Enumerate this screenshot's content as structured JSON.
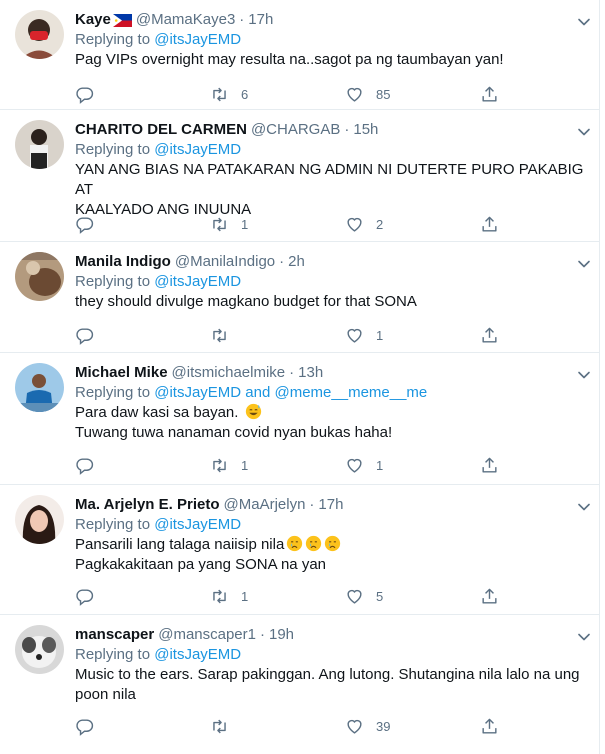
{
  "tweets": [
    {
      "name": "Kaye",
      "flag": "philippines-flag",
      "handle": "@MamaKaye3",
      "time": "17h",
      "replying_prefix": "Replying to ",
      "replying_to": "@itsJayEMD",
      "lines": [
        "Pag VIPs overnight may resulta na..sagot pa ng taumbayan yan!"
      ],
      "retweets": "6",
      "likes": "85"
    },
    {
      "name": "CHARITO DEL CARMEN",
      "handle": "@CHARGAB",
      "time": "15h",
      "replying_prefix": "Replying to ",
      "replying_to": "@itsJayEMD",
      "lines": [
        "YAN ANG BIAS NA PATAKARAN NG ADMIN NI DUTERTE PURO PAKABIG AT",
        "KAALYADO ANG INUUNA"
      ],
      "retweets": "1",
      "likes": "2"
    },
    {
      "name": "Manila Indigo",
      "handle": "@ManilaIndigo",
      "time": "2h",
      "replying_prefix": "Replying to ",
      "replying_to": "@itsJayEMD",
      "lines": [
        "they should divulge magkano budget for that SONA"
      ],
      "retweets": "",
      "likes": "1"
    },
    {
      "name": "Michael Mike",
      "handle": "@itsmichaelmike",
      "time": "13h",
      "replying_prefix": "Replying to ",
      "replying_to": "@itsJayEMD and @meme__meme__me",
      "lines": [
        "Para daw kasi sa bayan.",
        "Tuwang tuwa nanaman covid nyan bukas haha!"
      ],
      "emoji_line1": "sweat-smile-emoji",
      "retweets": "1",
      "likes": "1"
    },
    {
      "name": "Ma. Arjelyn E. Prieto",
      "handle": "@MaArjelyn",
      "time": "17h",
      "replying_prefix": "Replying to ",
      "replying_to": "@itsJayEMD",
      "lines": [
        "Pansarili lang talaga naiisip nila",
        "Pagkakakitaan pa yang SONA na yan"
      ],
      "emoji_line1": "crying-face-emoji x3",
      "retweets": "1",
      "likes": "5"
    },
    {
      "name": "manscaper",
      "handle": "@manscaper1",
      "time": "19h",
      "replying_prefix": "Replying to ",
      "replying_to": "@itsJayEMD",
      "lines": [
        "Music to the ears. Sarap pakinggan. Ang lutong. Shutangina nila lalo na ung",
        "poon nila"
      ],
      "retweets": "",
      "likes": "39"
    }
  ],
  "dot": "·",
  "colors": {
    "link": "#1b95e0",
    "muted": "#5b7083",
    "text": "#0f1419",
    "divider": "#e6ecf0"
  }
}
